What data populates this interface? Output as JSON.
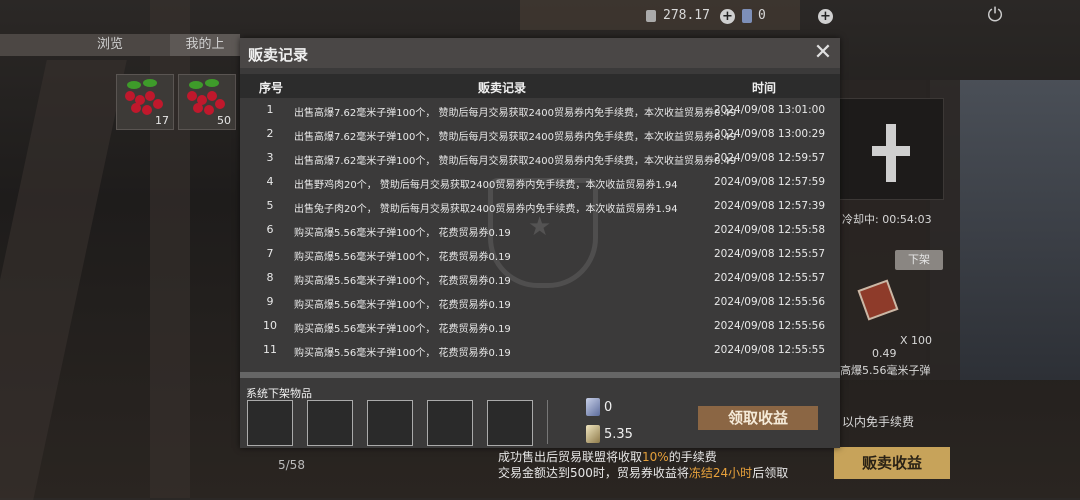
{
  "topbar": {
    "currency_value": "278.17",
    "coupon_value": "0",
    "currency_plus": "+",
    "coupon_plus": "+",
    "extra_plus": "+",
    "power_icon": "power-icon"
  },
  "tabs": [
    {
      "label": "浏览"
    },
    {
      "label": "我的上"
    }
  ],
  "inventory": [
    {
      "icon": "berry-icon",
      "count": "17"
    },
    {
      "icon": "berry-icon",
      "count": "50"
    }
  ],
  "right_panel": {
    "cooldown": "冷却中: 00:54:03",
    "unlist_label": "下架",
    "item_qty": "X 100",
    "item_price": "0.49",
    "item_name": "高爆5.56毫米子弹",
    "fee_text": "以内免手续费",
    "sell_income_label": "贩卖收益"
  },
  "notice": {
    "line1_a": "成功售出后贸易联盟将收取",
    "line1_hl": "10%",
    "line1_b": "的手续费",
    "line2_a": "交易金额达到500时，贸易券收益将",
    "line2_hl": "冻结24小时",
    "line2_b": "后领取"
  },
  "page_indicator": "5/58",
  "modal": {
    "title": "贩卖记录",
    "close_icon": "close-icon",
    "headers": {
      "num": "序号",
      "record": "贩卖记录",
      "time": "时间"
    },
    "rows": [
      {
        "num": "1",
        "record": "出售高爆7.62毫米子弹100个，  赞助后每月交易获取2400贸易券内免手续费，本次收益贸易券0.49",
        "time": "2024/09/08 13:01:00"
      },
      {
        "num": "2",
        "record": "出售高爆7.62毫米子弹100个，  赞助后每月交易获取2400贸易券内免手续费，本次收益贸易券0.49",
        "time": "2024/09/08 13:00:29"
      },
      {
        "num": "3",
        "record": "出售高爆7.62毫米子弹100个，  赞助后每月交易获取2400贸易券内免手续费，本次收益贸易券0.49",
        "time": "2024/09/08 12:59:57"
      },
      {
        "num": "4",
        "record": "出售野鸡肉20个，  赞助后每月交易获取2400贸易券内免手续费，本次收益贸易券1.94",
        "time": "2024/09/08 12:57:59"
      },
      {
        "num": "5",
        "record": "出售兔子肉20个，  赞助后每月交易获取2400贸易券内免手续费，本次收益贸易券1.94",
        "time": "2024/09/08 12:57:39"
      },
      {
        "num": "6",
        "record": "购买高爆5.56毫米子弹100个，  花费贸易券0.19",
        "time": "2024/09/08 12:55:58"
      },
      {
        "num": "7",
        "record": "购买高爆5.56毫米子弹100个，  花费贸易券0.19",
        "time": "2024/09/08 12:55:57"
      },
      {
        "num": "8",
        "record": "购买高爆5.56毫米子弹100个，  花费贸易券0.19",
        "time": "2024/09/08 12:55:57"
      },
      {
        "num": "9",
        "record": "购买高爆5.56毫米子弹100个，  花费贸易券0.19",
        "time": "2024/09/08 12:55:56"
      },
      {
        "num": "10",
        "record": "购买高爆5.56毫米子弹100个，  花费贸易券0.19",
        "time": "2024/09/08 12:55:56"
      },
      {
        "num": "11",
        "record": "购买高爆5.56毫米子弹100个，  花费贸易券0.19",
        "time": "2024/09/08 12:55:55"
      }
    ],
    "system_label": "系统下架物品",
    "coupon_amount": "0",
    "gold_amount": "5.35",
    "claim_label": "领取收益"
  }
}
